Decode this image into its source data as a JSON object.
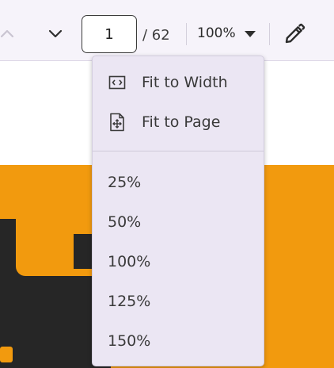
{
  "toolbar": {
    "page_current": "1",
    "page_total": "/ 62",
    "zoom_value": "100%",
    "icons": {
      "prev": "chevron-up-icon",
      "next": "chevron-down-icon",
      "zoom_caret": "caret-down-icon",
      "edit": "pencil-icon"
    }
  },
  "zoom_menu": {
    "fit_items": [
      {
        "label": "Fit to Width",
        "icon": "fit-to-width-icon"
      },
      {
        "label": "Fit to Page",
        "icon": "fit-to-page-icon"
      }
    ],
    "levels": [
      "25%",
      "50%",
      "100%",
      "125%",
      "150%"
    ]
  },
  "colors": {
    "toolbar_bg": "#f6f3fa",
    "menu_bg": "#ebe6f3",
    "doc_orange": "#f29a0e",
    "doc_dark": "#262626"
  }
}
